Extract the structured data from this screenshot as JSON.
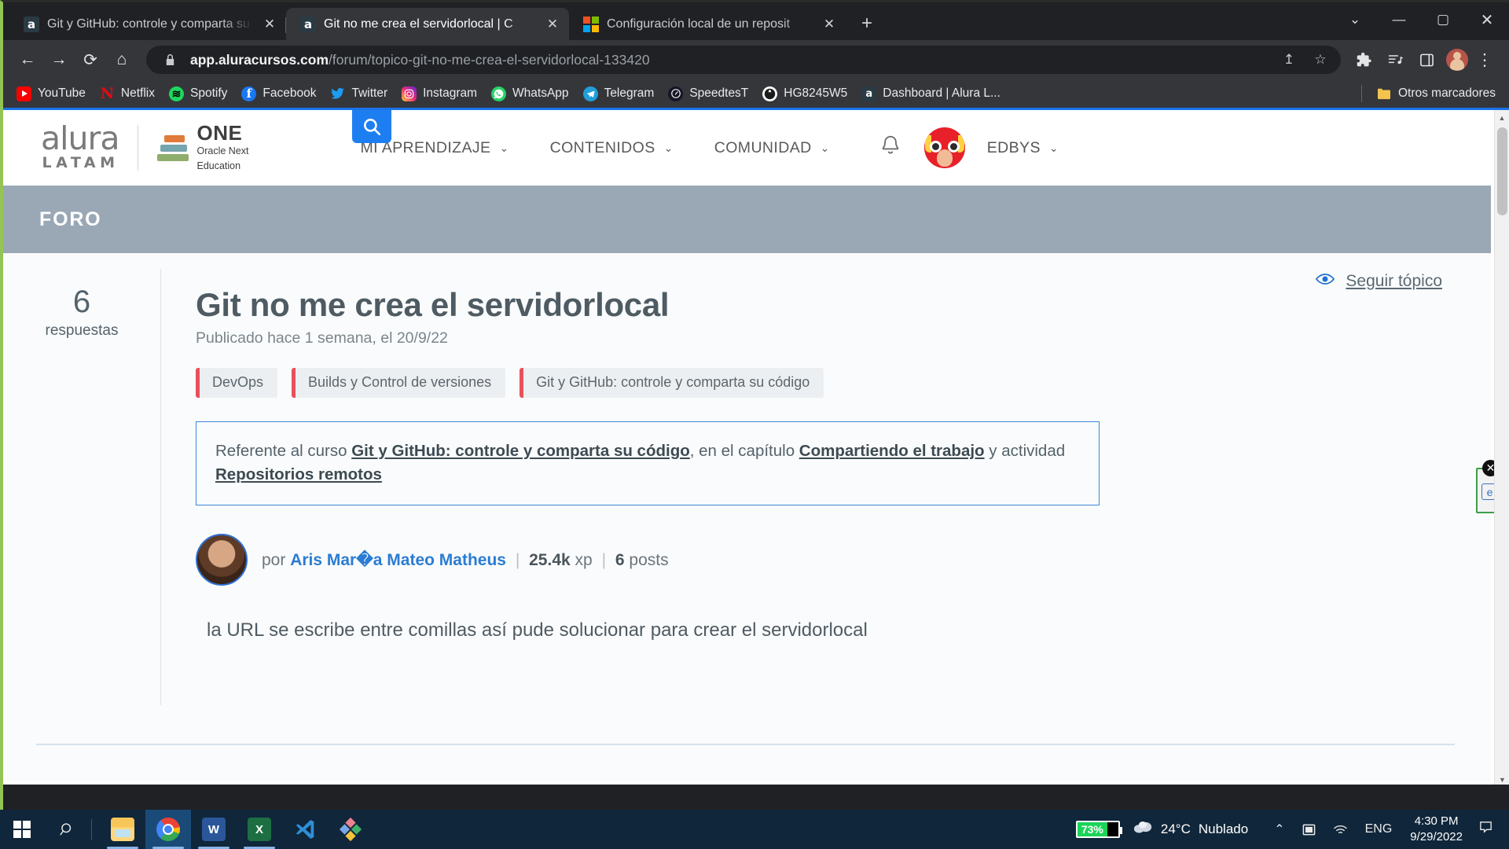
{
  "browser": {
    "tabs": [
      {
        "title": "Git y GitHub: controle y comparta su código",
        "favicon": "alura-icon",
        "active": false
      },
      {
        "title": "Git no me crea el servidorlocal | C",
        "favicon": "alura-icon",
        "active": true
      },
      {
        "title": "Configuración local de un reposit",
        "favicon": "microsoft-icon",
        "active": false
      }
    ],
    "new_tab_label": "+",
    "window_controls": {
      "minimize": "—",
      "maximize": "▢",
      "close": "✕",
      "chevron": "⌄"
    },
    "nav": {
      "back": "←",
      "forward": "→",
      "reload": "⟳",
      "home": "⌂"
    },
    "omnibox": {
      "lock_icon": "lock-icon",
      "url_bold": "app.aluracursos.com",
      "url_rest": "/forum/topico-git-no-me-crea-el-servidorlocal-133420",
      "share_icon": "↥",
      "bookmark_icon": "☆"
    },
    "toolbar_right": {
      "extensions": "🧩",
      "reading_list": "≡♪",
      "side_panel": "▯",
      "menu": "⋮"
    },
    "bookmarks": [
      {
        "label": "YouTube",
        "icon": "youtube-icon"
      },
      {
        "label": "Netflix",
        "icon": "netflix-icon",
        "glyph": "N"
      },
      {
        "label": "Spotify",
        "icon": "spotify-icon",
        "glyph": "≋"
      },
      {
        "label": "Facebook",
        "icon": "facebook-icon",
        "glyph": "f"
      },
      {
        "label": "Twitter",
        "icon": "twitter-icon",
        "glyph": "🐦"
      },
      {
        "label": "Instagram",
        "icon": "instagram-icon",
        "glyph": "▣"
      },
      {
        "label": "WhatsApp",
        "icon": "whatsapp-icon",
        "glyph": "✆"
      },
      {
        "label": "Telegram",
        "icon": "telegram-icon",
        "glyph": "➤"
      },
      {
        "label": "SpeedtesT",
        "icon": "speedtest-icon",
        "glyph": "◔"
      },
      {
        "label": "HG8245W5",
        "icon": "globe-icon",
        "glyph": "🌐"
      },
      {
        "label": "Dashboard | Alura L...",
        "icon": "alura-icon",
        "glyph": "a"
      }
    ],
    "other_bookmarks": {
      "label": "Otros marcadores",
      "icon": "folder-icon",
      "glyph": "📁"
    }
  },
  "site": {
    "logo": {
      "word": "alura",
      "sub": "LATAM"
    },
    "one_logo": {
      "main": "ONE",
      "line1": "Oracle Next",
      "line2": "Education"
    },
    "search_icon": "search-icon",
    "nav": [
      {
        "label": "MI APRENDIZAJE",
        "caret": "⌄"
      },
      {
        "label": "CONTENIDOS",
        "caret": "⌄"
      },
      {
        "label": "COMUNIDAD",
        "caret": "⌄"
      }
    ],
    "bell_icon": "bell-icon",
    "username": "EDBYS",
    "user_caret": "⌄",
    "banner_label": "FORO"
  },
  "topic": {
    "answers_count": "6",
    "answers_label": "respuestas",
    "title": "Git no me crea el servidorlocal",
    "date": "Publicado hace 1 semana, el 20/9/22",
    "tags": [
      "DevOps",
      "Builds y Control de versiones",
      "Git y GitHub: controle y comparta su código"
    ],
    "reference": {
      "p1": "Referente al curso ",
      "course": "Git y GitHub: controle y comparta su código",
      "p2": ", en el capítulo ",
      "chapter": "Compartiendo el trabajo",
      "p3": " y actividad ",
      "activity": "Repositorios remotos"
    },
    "author": {
      "prefix": "por",
      "name": "Aris Mar�a Mateo Matheus",
      "xp": "25.4k",
      "xp_label": "xp",
      "posts": "6",
      "posts_label": "posts",
      "separator": "|"
    },
    "body": "la URL se escribe entre comillas así pude solucionar para crear el servidorlocal",
    "follow": {
      "icon": "eye-icon",
      "label": "Seguir tópico"
    }
  },
  "side_widget": {
    "close_icon": "close-icon",
    "glyph": "✕",
    "body_icon": "translate-icon",
    "body_glyph": "e"
  },
  "taskbar": {
    "start_icon": "windows-icon",
    "search_icon": "search-icon",
    "apps": [
      {
        "name": "file-explorer",
        "label": "File Explorer",
        "active": false,
        "open": true
      },
      {
        "name": "chrome",
        "label": "Google Chrome",
        "active": true,
        "open": true
      },
      {
        "name": "word",
        "label": "Microsoft Word",
        "glyph": "W",
        "active": false,
        "open": true
      },
      {
        "name": "excel",
        "label": "Microsoft Excel",
        "glyph": "X",
        "active": false,
        "open": true
      },
      {
        "name": "vscode",
        "label": "Visual Studio Code",
        "glyph": "✕",
        "active": false,
        "open": false
      },
      {
        "name": "other-app",
        "label": "App",
        "glyph": "◈",
        "active": false,
        "open": false
      }
    ],
    "battery": {
      "percent": "73%",
      "level": 73
    },
    "weather": {
      "icon": "cloud-icon",
      "temperature": "24°C",
      "condition": "Nublado"
    },
    "tray": {
      "chevron": "⌃",
      "display": "▣",
      "wifi": "📶",
      "language": "ENG"
    },
    "clock": {
      "time": "4:30 PM",
      "date": "9/29/2022"
    },
    "notification_icon": "notification-icon"
  }
}
